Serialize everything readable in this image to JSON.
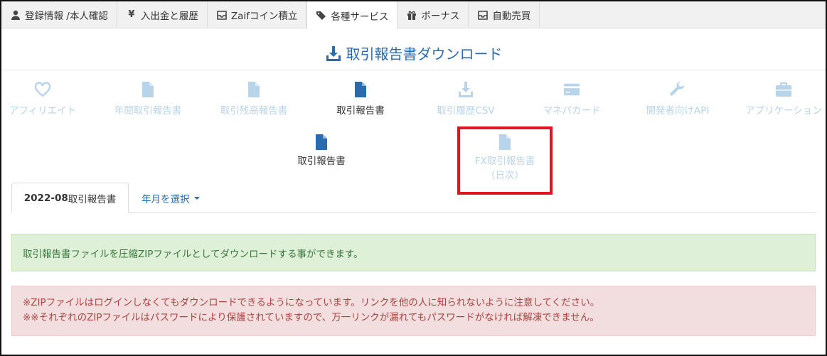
{
  "top_tabs": [
    {
      "label": "登録情報 /本人確認",
      "icon": "user-icon"
    },
    {
      "label": "入出金と履歴",
      "icon": "yen-icon"
    },
    {
      "label": "Zaifコイン積立",
      "icon": "inbox-icon"
    },
    {
      "label": "各種サービス",
      "icon": "tags-icon",
      "active": true
    },
    {
      "label": "ボーナス",
      "icon": "gift-icon"
    },
    {
      "label": "自動売買",
      "icon": "inbox-icon"
    }
  ],
  "page_title": "取引報告書ダウンロード",
  "services": [
    {
      "label": "アフィリエイト",
      "icon": "heart-icon"
    },
    {
      "label": "年間取引報告書",
      "icon": "file-icon"
    },
    {
      "label": "取引残高報告書",
      "icon": "file-icon"
    },
    {
      "label": "取引報告書",
      "icon": "file-icon",
      "active": true
    },
    {
      "label": "取引履歴CSV",
      "icon": "download-icon"
    },
    {
      "label": "マネパカード",
      "icon": "card-icon"
    },
    {
      "label": "開発者向けAPI",
      "icon": "wrench-icon"
    },
    {
      "label": "アプリケーション",
      "icon": "briefcase-icon"
    }
  ],
  "subservices": [
    {
      "label": "取引報告書",
      "icon": "file-icon",
      "active": true
    },
    {
      "label_line1": "FX取引報告書",
      "label_line2": "（日次）",
      "icon": "file-icon"
    }
  ],
  "report_tabs": {
    "active_tab_bold": "2022-08",
    "active_tab_rest": "取引報告書",
    "select_label": "年月を選択"
  },
  "info_message": "取引報告書ファイルを圧縮ZIPファイルとしてダウンロードする事ができます。",
  "warnings": [
    "※ZIPファイルはログインしなくてもダウンロードできるようになっています。リンクを他の人に知られないように注意してください。",
    "※※それぞれのZIPファイルはパスワードにより保護されていますので、万一リンクが漏れてもパスワードがなければ解凍できません。"
  ],
  "colors": {
    "accent": "#2a6bb0",
    "inactive": "#b8d4ea",
    "highlight": "#e0161e",
    "success_bg": "#dff0d8",
    "danger_bg": "#f2dede"
  }
}
